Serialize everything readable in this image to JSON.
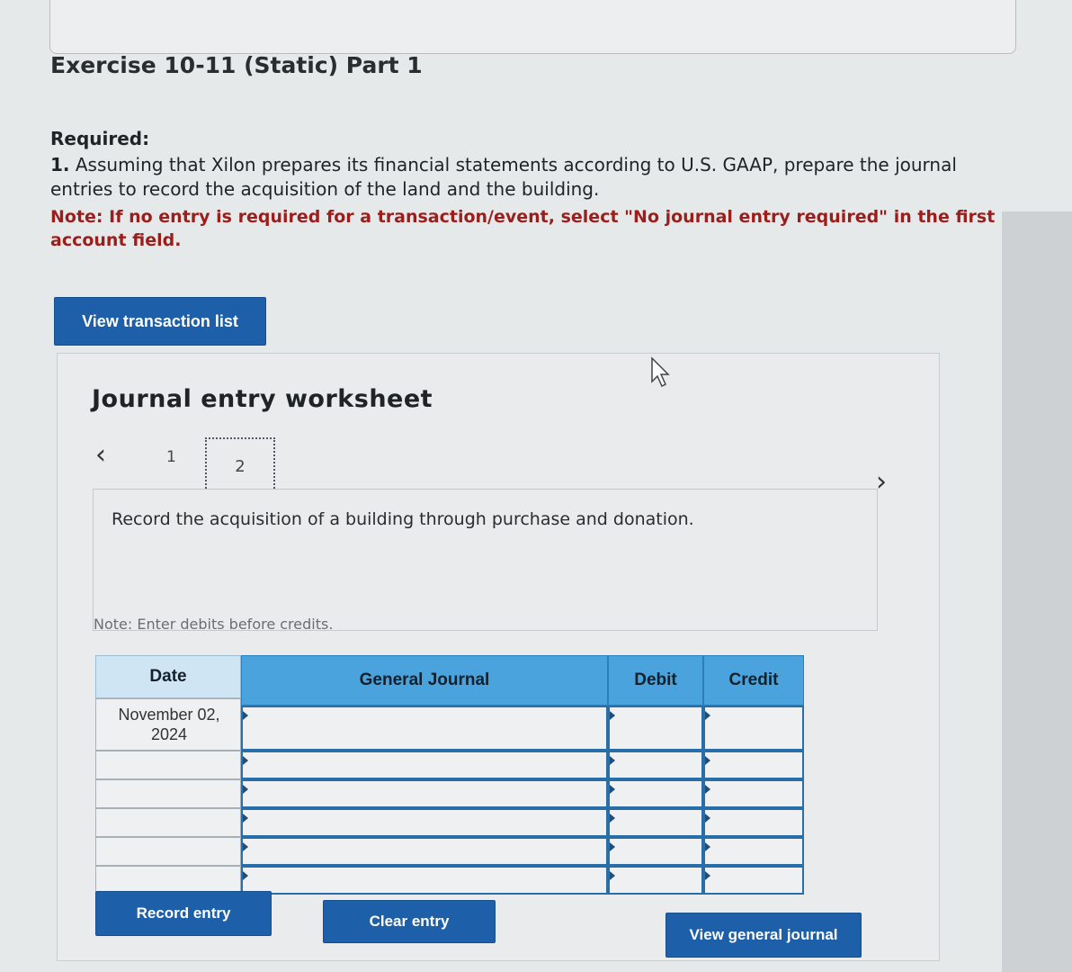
{
  "exercise": {
    "title": "Exercise 10-11 (Static) Part 1"
  },
  "required": {
    "label": "Required:",
    "item_number": "1.",
    "text": "Assuming that Xilon prepares its financial statements according to U.S. GAAP, prepare the journal entries to record the acquisition of the land and the building.",
    "note": "Note: If no entry is required for a transaction/event, select \"No journal entry required\" in the first account field."
  },
  "buttons": {
    "view_transaction_list": "View transaction list",
    "record_entry": "Record entry",
    "clear_entry": "Clear entry",
    "view_general_journal": "View general journal"
  },
  "worksheet": {
    "title": "Journal entry worksheet",
    "pages": [
      "1",
      "2"
    ],
    "current_page": "2",
    "description": "Record the acquisition of a building through purchase and donation.",
    "note": "Note: Enter debits before credits."
  },
  "journal": {
    "headers": {
      "date": "Date",
      "general_journal": "General Journal",
      "debit": "Debit",
      "credit": "Credit"
    },
    "date_value_line1": "November 02,",
    "date_value_line2": "2024",
    "rows": 6
  },
  "colors": {
    "accent_button": "#1d5fa8",
    "header_blue": "#4aa3dd",
    "note_red": "#9a1f1c"
  }
}
